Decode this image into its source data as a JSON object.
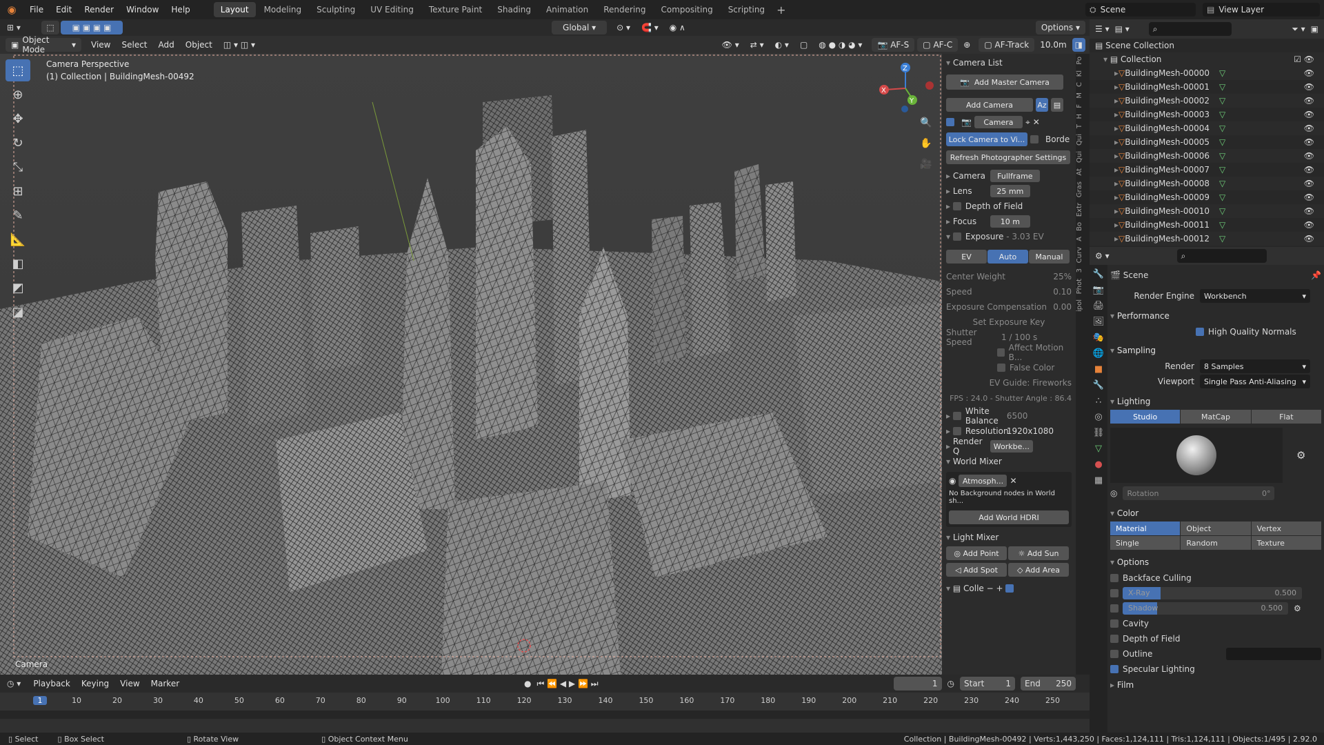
{
  "topbar": {
    "menus": [
      "File",
      "Edit",
      "Render",
      "Window",
      "Help"
    ],
    "workspaces": [
      "Layout",
      "Modeling",
      "Sculpting",
      "UV Editing",
      "Texture Paint",
      "Shading",
      "Animation",
      "Rendering",
      "Compositing",
      "Scripting"
    ],
    "active_workspace": "Layout",
    "scene_name": "Scene",
    "view_layer": "View Layer"
  },
  "header2": {
    "orientation": "Global",
    "options": "Options"
  },
  "viewport_header": {
    "mode": "Object Mode",
    "menus": [
      "View",
      "Select",
      "Add",
      "Object"
    ],
    "af_s": "AF-S",
    "af_c": "AF-C",
    "af_track": "AF-Track",
    "distance": "10.0m"
  },
  "viewport": {
    "title": "Camera Perspective",
    "subtitle": "(1) Collection | BuildingMesh-00492",
    "camera_label": "Camera"
  },
  "camera_panel": {
    "title": "Camera List",
    "add_master": "Add Master Camera",
    "add_camera": "Add Camera",
    "camera_name": "Camera",
    "lock_camera": "Lock Camera to Vi...",
    "border": "Borde",
    "refresh": "Refresh Photographer Settings",
    "camera_label": "Camera",
    "camera_value": "Fullframe",
    "lens_label": "Lens",
    "lens_value": "25 mm",
    "dof_label": "Depth of Field",
    "focus_label": "Focus",
    "focus_value": "10 m",
    "exposure_label": "Exposure",
    "exposure_value": "- 3.03 EV",
    "exp_tabs": [
      "EV",
      "Auto",
      "Manual"
    ],
    "exp_active": "Auto",
    "center_weight_label": "Center Weight",
    "center_weight_value": "25%",
    "speed_label": "Speed",
    "speed_value": "0.10",
    "exp_comp_label": "Exposure Compensation",
    "exp_comp_value": "0.00",
    "set_exposure_key": "Set Exposure Key",
    "shutter_label": "Shutter Speed",
    "shutter_value": "1 / 100 s",
    "affect_motion": "Affect Motion B...",
    "false_color": "False Color",
    "ev_guide": "EV Guide: Fireworks",
    "fps_info": "FPS : 24.0 - Shutter Angle : 86.4",
    "white_balance_label": "White Balance",
    "white_balance_value": "6500",
    "resolution_label": "Resolution",
    "resolution_value": "1920x1080",
    "render_q_label": "Render Q",
    "render_q_value": "Workbe...",
    "world_mixer": "World Mixer",
    "world_name": "Atmosph...",
    "world_msg": "No Background nodes in World sh...",
    "add_hdri": "Add World HDRI",
    "light_mixer": "Light Mixer",
    "add_point": "Add Point",
    "add_sun": "Add Sun",
    "add_spot": "Add Spot",
    "add_area": "Add Area",
    "colle": "Colle"
  },
  "side_tabs": [
    "Po",
    "Kl",
    "C",
    "M",
    "F",
    "H",
    "T",
    "Qui",
    "Qui",
    "At",
    "Gras",
    "Extr",
    "Bo",
    "A",
    "Curv",
    "3",
    "Phot",
    "ipol"
  ],
  "outliner": {
    "root": "Scene Collection",
    "collection": "Collection",
    "items": [
      "BuildingMesh-00000",
      "BuildingMesh-00001",
      "BuildingMesh-00002",
      "BuildingMesh-00003",
      "BuildingMesh-00004",
      "BuildingMesh-00005",
      "BuildingMesh-00006",
      "BuildingMesh-00007",
      "BuildingMesh-00008",
      "BuildingMesh-00009",
      "BuildingMesh-00010",
      "BuildingMesh-00011",
      "BuildingMesh-00012"
    ]
  },
  "properties": {
    "scene": "Scene",
    "render_engine_label": "Render Engine",
    "render_engine": "Workbench",
    "performance": "Performance",
    "hq_normals": "High Quality Normals",
    "sampling": "Sampling",
    "render_label": "Render",
    "render_value": "8 Samples",
    "viewport_label": "Viewport",
    "viewport_value": "Single Pass Anti-Aliasing",
    "lighting": "Lighting",
    "light_modes": [
      "Studio",
      "MatCap",
      "Flat"
    ],
    "light_active": "Studio",
    "rotation_label": "Rotation",
    "rotation_value": "0°",
    "color": "Color",
    "color_modes": [
      "Material",
      "Object",
      "Vertex",
      "Single",
      "Random",
      "Texture"
    ],
    "color_active": "Material",
    "options": "Options",
    "backface": "Backface Culling",
    "xray_label": "X-Ray",
    "xray_value": "0.500",
    "xray_level": 0.5,
    "shadow_label": "Shadow",
    "shadow_value": "0.500",
    "shadow_level": 0.5,
    "cavity": "Cavity",
    "dof": "Depth of Field",
    "outline": "Outline",
    "specular": "Specular Lighting",
    "film": "Film"
  },
  "timeline": {
    "menus": [
      "Playback",
      "Keying",
      "View",
      "Marker"
    ],
    "current_frame": "1",
    "start_label": "Start",
    "start": "1",
    "end_label": "End",
    "end": "250",
    "ticks": [
      "1",
      "10",
      "20",
      "30",
      "40",
      "50",
      "60",
      "70",
      "80",
      "90",
      "100",
      "110",
      "120",
      "130",
      "140",
      "150",
      "160",
      "170",
      "180",
      "190",
      "200",
      "210",
      "220",
      "230",
      "240",
      "250"
    ]
  },
  "statusbar": {
    "select": "Select",
    "box_select": "Box Select",
    "rotate": "Rotate View",
    "context": "Object Context Menu",
    "info": "Collection | BuildingMesh-00492 | Verts:1,443,250 | Faces:1,124,111 | Tris:1,124,111 | Objects:1/495 | 2.92.0"
  },
  "colors": {
    "accent": "#4772b3",
    "orange": "#e6833a",
    "mesh_green": "#6fd07a"
  }
}
